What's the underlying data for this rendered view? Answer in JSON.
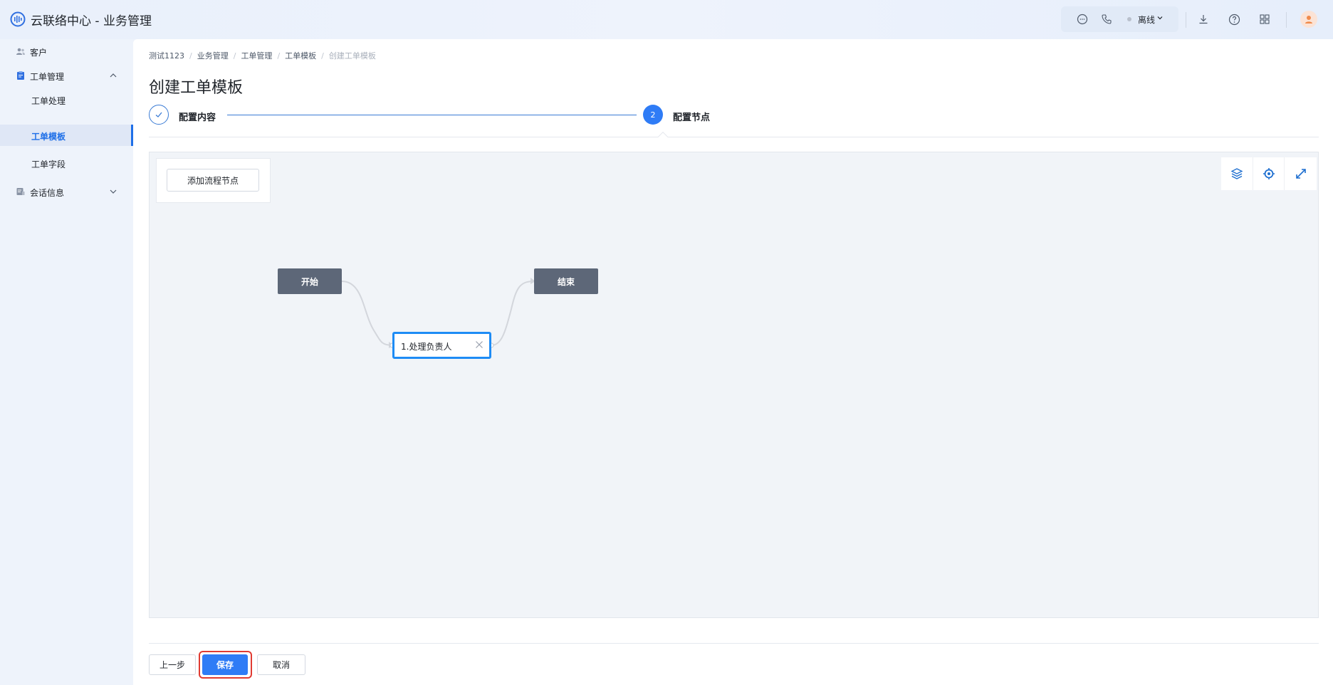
{
  "app": {
    "title": "云联络中心 - 业务管理"
  },
  "header": {
    "status_label": "离线",
    "icons": [
      "chat-icon",
      "phone-icon",
      "download-icon",
      "help-icon",
      "apps-grid-icon",
      "avatar"
    ]
  },
  "sidebar": {
    "items": [
      {
        "label": "客户",
        "icon": "users-icon"
      },
      {
        "label": "工单管理",
        "icon": "clipboard-icon",
        "expanded": true
      },
      {
        "label": "工单处理"
      },
      {
        "label": "工单模板",
        "active": true
      },
      {
        "label": "工单字段"
      },
      {
        "label": "会话信息",
        "icon": "chat-record-icon",
        "expanded": false
      }
    ]
  },
  "breadcrumb": [
    "测试1123",
    "业务管理",
    "工单管理",
    "工单模板",
    "创建工单模板"
  ],
  "page": {
    "title": "创建工单模板"
  },
  "steps": [
    {
      "label": "配置内容",
      "status": "done"
    },
    {
      "index": "2",
      "label": "配置节点",
      "status": "active"
    }
  ],
  "canvas": {
    "add_node_label": "添加流程节点",
    "tools": [
      "layers-icon",
      "locate-icon",
      "fullscreen-icon"
    ],
    "nodes": {
      "start": "开始",
      "task": "1.处理负责人",
      "end": "结束"
    }
  },
  "footer": {
    "prev_label": "上一步",
    "save_label": "保存",
    "cancel_label": "取消"
  },
  "colors": {
    "primary": "#2f7cf6",
    "node_dark": "#5d6778",
    "highlight": "#e03b32"
  }
}
